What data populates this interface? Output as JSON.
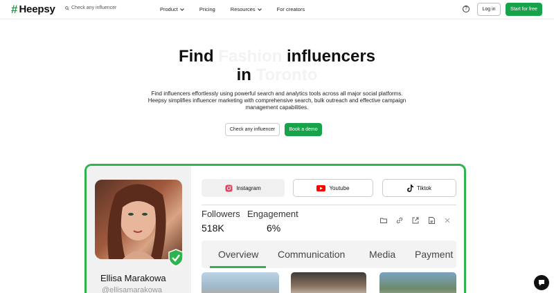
{
  "nav": {
    "logo_mark": "#",
    "logo_text": "Heepsy",
    "search_placeholder": "Check any influencer",
    "links": [
      "Product",
      "Pricing",
      "Resources",
      "For creators"
    ],
    "help_icon": "question-circle-icon",
    "login": "Log in",
    "start": "Start for free"
  },
  "hero": {
    "title_1a": "Find",
    "title_1b": "Fashion",
    "title_1c": "influencers",
    "title_2a": "in",
    "title_2b": "Toronto",
    "subtitle": "Find influencers effortlessly using powerful search and analytics tools across all major social platforms. Heepsy simplifies influencer marketing with comprehensive search, bulk outreach and effective campaign management capabilities.",
    "btn_check": "Check any influencer",
    "btn_demo": "Book a demo"
  },
  "card": {
    "name": "Ellisa Marakowa",
    "handle": "@ellisamarakowa",
    "platforms": [
      "Instagram",
      "Youtube",
      "Tiktok"
    ],
    "followers_label": "Followers",
    "followers_value": "518K",
    "engagement_label": "Engagement",
    "engagement_value": "6%",
    "subtabs": [
      "Overview",
      "Communication",
      "Media",
      "Payment"
    ]
  },
  "colors": {
    "accent": "#16a34a",
    "card_border": "#2fb34f"
  }
}
